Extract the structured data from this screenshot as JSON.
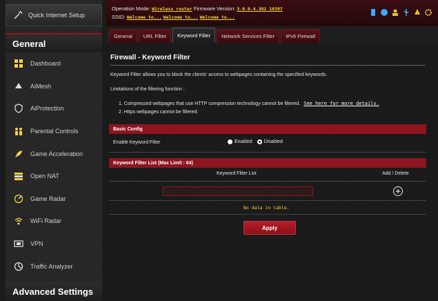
{
  "sidebar": {
    "quick_setup_label": "Quick Internet Setup",
    "general_label": "General",
    "advanced_label": "Advanced Settings",
    "items": [
      {
        "label": "Dashboard",
        "icon": "dashboard-icon"
      },
      {
        "label": "AiMesh",
        "icon": "aimesh-icon"
      },
      {
        "label": "AiProtection",
        "icon": "shield-icon"
      },
      {
        "label": "Parental Controls",
        "icon": "family-icon"
      },
      {
        "label": "Game Acceleration",
        "icon": "rocket-icon"
      },
      {
        "label": "Open NAT",
        "icon": "open-nat-icon"
      },
      {
        "label": "Game Radar",
        "icon": "radar-icon"
      },
      {
        "label": "WiFi Radar",
        "icon": "wifi-radar-icon"
      },
      {
        "label": "VPN",
        "icon": "vpn-icon"
      },
      {
        "label": "Traffic Analyzer",
        "icon": "traffic-icon"
      }
    ]
  },
  "topbar": {
    "operation_mode_label": "Operation Mode:",
    "operation_mode_value": "Wireless router",
    "firmware_label": "Firmware Version:",
    "firmware_value": "3.0.0.4.382_10397",
    "ssid_label": "SSID:",
    "ssid_values": [
      "Welcome to...",
      "Welcome to...",
      "Welcome to..."
    ]
  },
  "tabs": [
    {
      "label": "General",
      "active": false
    },
    {
      "label": "URL Filter",
      "active": false
    },
    {
      "label": "Keyword Filter",
      "active": true
    },
    {
      "label": "Network Services Filter",
      "active": false
    },
    {
      "label": "IPv6 Firewall",
      "active": false
    }
  ],
  "main": {
    "title": "Firewall - Keyword Filter",
    "description": "Keyword Filter allows you to block the clients' access to webpages containing the specified keywords.",
    "limits_title": "Limitations of the filtering function :",
    "limit1": "1. Compressed webpages that use HTTP compression technology cannot be filtered.",
    "limit1_link": "See here for more details.",
    "limit2": "2. Https webpages cannot be filtered.",
    "basic_config_label": "Basic Config",
    "enable_label": "Enable Keyword Filter",
    "enabled_option": "Enabled",
    "disabled_option": "Disabled",
    "selected_option": "Enabled",
    "list_header": "Keyword Filter List (Max Limit : 64)",
    "col_list": "Keyword Filter List",
    "col_add": "Add / Delete",
    "keyword_value": "",
    "empty_message": "No data in table.",
    "apply_label": "Apply"
  },
  "colors": {
    "accent": "#8d1520",
    "highlight": "#ffd23a",
    "background": "#1b1b1b"
  }
}
